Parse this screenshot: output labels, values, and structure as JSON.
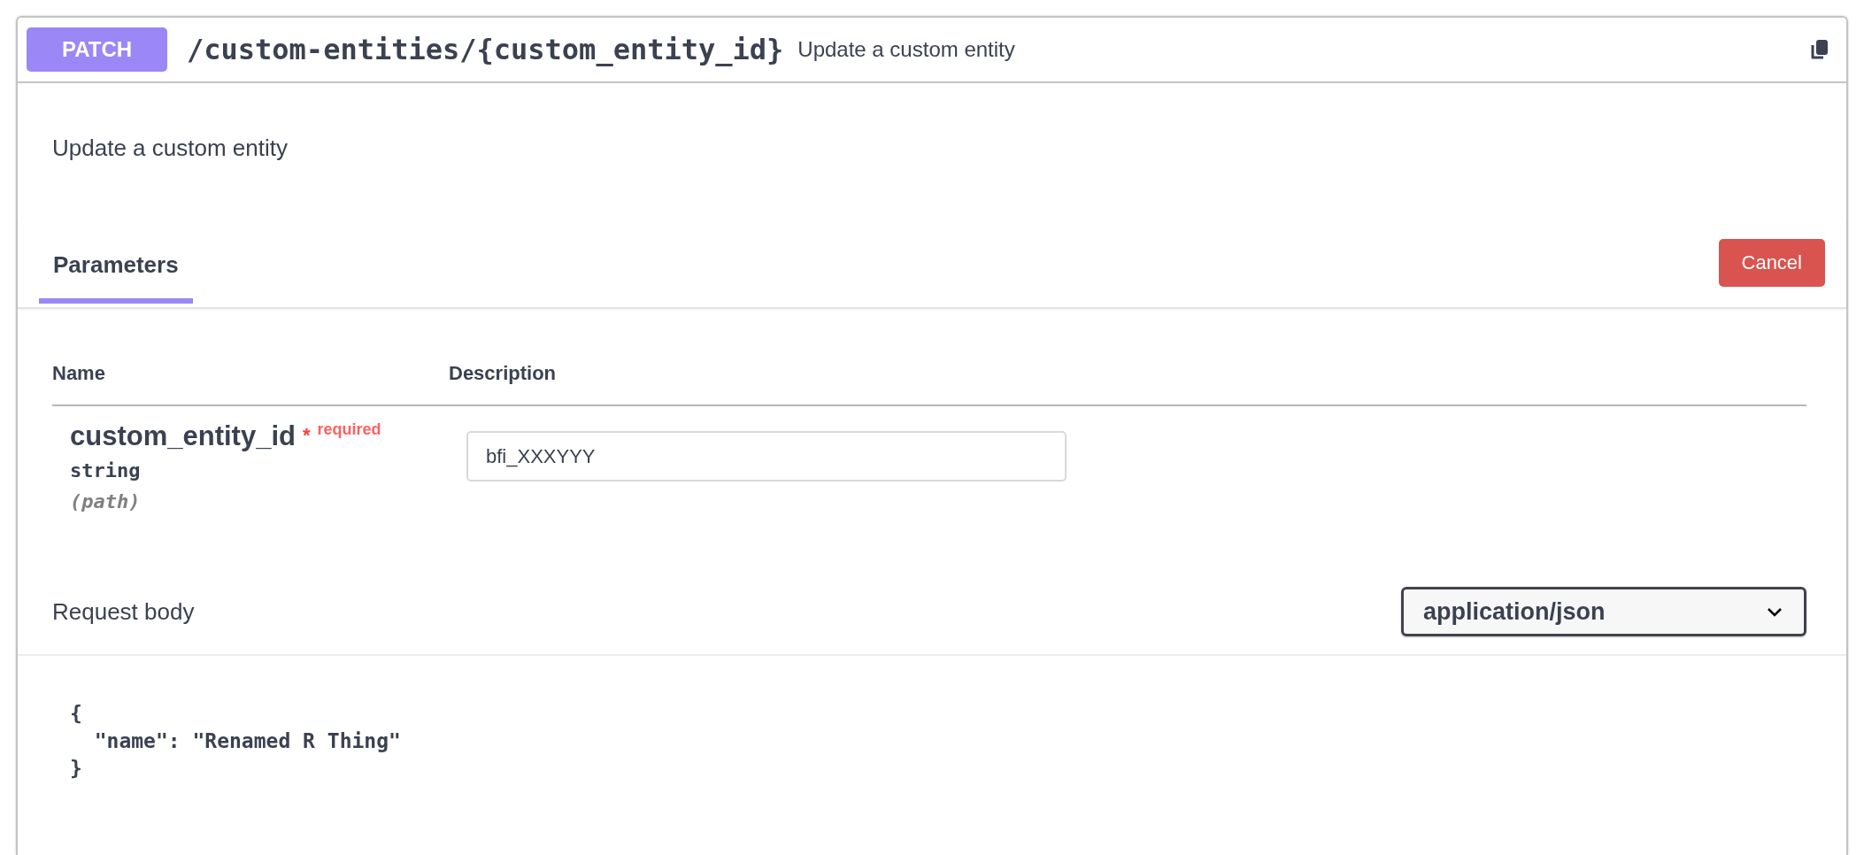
{
  "operation": {
    "method": "PATCH",
    "path": "/custom-entities/{custom_entity_id}",
    "summary": "Update a custom entity"
  },
  "description": "Update a custom entity",
  "tabs": [
    {
      "label": "Parameters",
      "selected": true
    }
  ],
  "cancel_button": "Cancel",
  "parameters": {
    "columns": [
      "Name",
      "Description"
    ],
    "rows": [
      {
        "name": "custom_entity_id",
        "required_mark": "*",
        "required_label": "required",
        "type": "string",
        "location": "(path)",
        "value": "bfi_XXXYYY"
      }
    ]
  },
  "request_body": {
    "label": "Request body",
    "content_type": "application/json",
    "code": [
      "{",
      "  \"name\": \"Renamed R Thing\"",
      "}"
    ]
  }
}
